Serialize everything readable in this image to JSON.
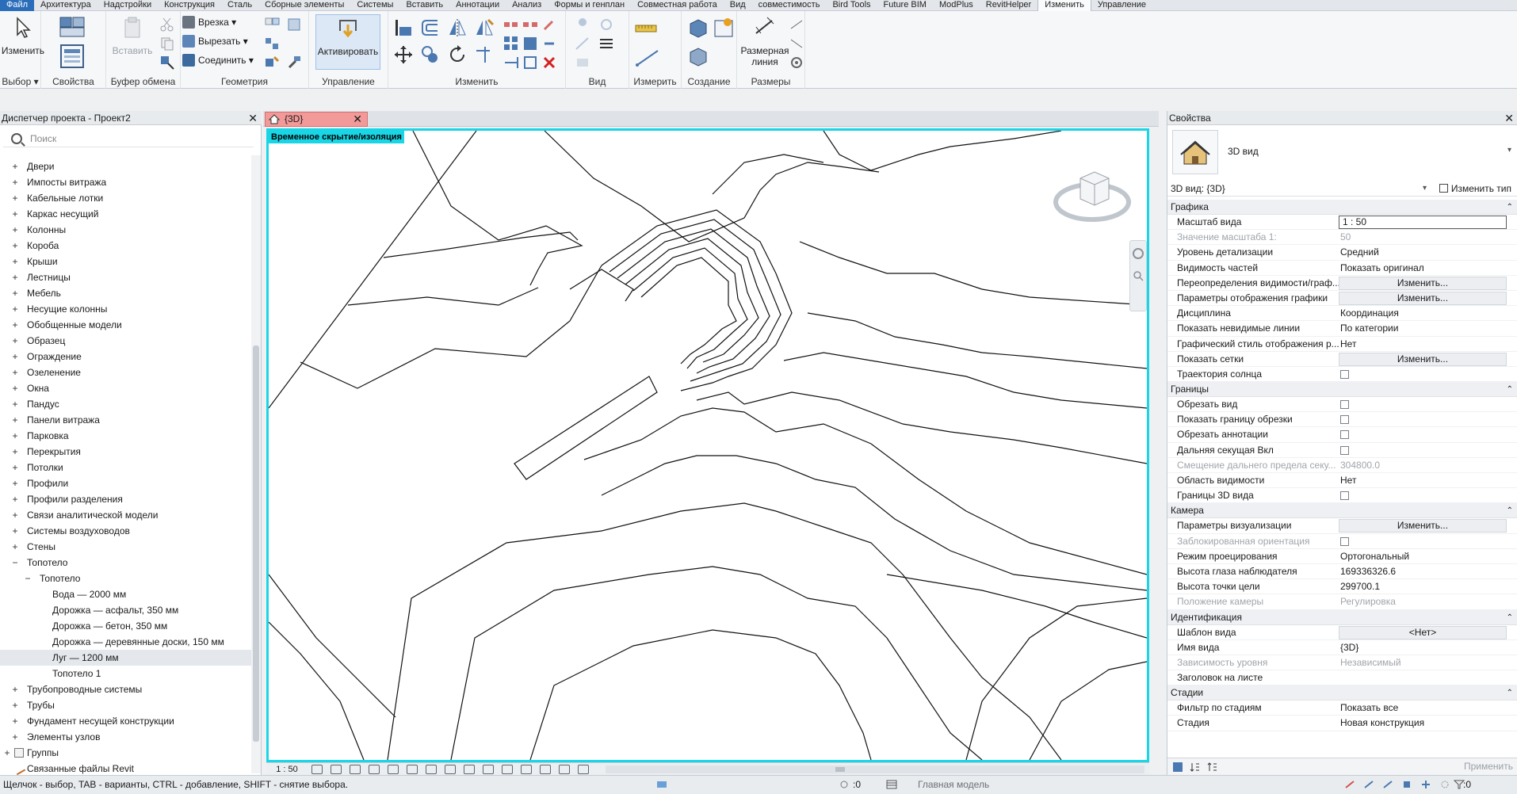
{
  "ribbon": {
    "tabs": [
      "Файл",
      "Архитектура",
      "Надстройки",
      "Конструкция",
      "Сталь",
      "Сборные элементы",
      "Системы",
      "Вставить",
      "Аннотации",
      "Анализ",
      "Формы и генплан",
      "Совместная работа",
      "Вид",
      "совместимость",
      "Bird Tools",
      "Future BIM",
      "ModPlus",
      "RevitHelper",
      "Изменить",
      "Управление"
    ],
    "active_tab": "Изменить",
    "groups": {
      "select_label": "Выбор",
      "properties_label": "Свойства",
      "clipboard_label": "Буфер обмена",
      "geometry_label": "Геометрия",
      "control_label": "Управление",
      "modify_label": "Изменить",
      "view_label": "Вид",
      "measure_label": "Измерить",
      "create_label": "Создание",
      "dimension_label": "Размеры"
    },
    "buttons": {
      "modify": "Изменить",
      "paste": "Вставить",
      "cut_in": "Врезка",
      "cut_out": "Вырезать",
      "join": "Соединить",
      "activate": "Активировать",
      "aligned_dim": "Размерная",
      "aligned_dim_2": "линия"
    }
  },
  "browser": {
    "title": "Диспетчер проекта - Проект2",
    "search_placeholder": "Поиск",
    "items": [
      {
        "label": "Двери",
        "level": 1,
        "expander": "+"
      },
      {
        "label": "Импосты витража",
        "level": 1,
        "expander": "+"
      },
      {
        "label": "Кабельные лотки",
        "level": 1,
        "expander": "+"
      },
      {
        "label": "Каркас несущий",
        "level": 1,
        "expander": "+"
      },
      {
        "label": "Колонны",
        "level": 1,
        "expander": "+"
      },
      {
        "label": "Короба",
        "level": 1,
        "expander": "+"
      },
      {
        "label": "Крыши",
        "level": 1,
        "expander": "+"
      },
      {
        "label": "Лестницы",
        "level": 1,
        "expander": "+"
      },
      {
        "label": "Мебель",
        "level": 1,
        "expander": "+"
      },
      {
        "label": "Несущие колонны",
        "level": 1,
        "expander": "+"
      },
      {
        "label": "Обобщенные модели",
        "level": 1,
        "expander": "+"
      },
      {
        "label": "Образец",
        "level": 1,
        "expander": "+"
      },
      {
        "label": "Ограждение",
        "level": 1,
        "expander": "+"
      },
      {
        "label": "Озеленение",
        "level": 1,
        "expander": "+"
      },
      {
        "label": "Окна",
        "level": 1,
        "expander": "+"
      },
      {
        "label": "Пандус",
        "level": 1,
        "expander": "+"
      },
      {
        "label": "Панели витража",
        "level": 1,
        "expander": "+"
      },
      {
        "label": "Парковка",
        "level": 1,
        "expander": "+"
      },
      {
        "label": "Перекрытия",
        "level": 1,
        "expander": "+"
      },
      {
        "label": "Потолки",
        "level": 1,
        "expander": "+"
      },
      {
        "label": "Профили",
        "level": 1,
        "expander": "+"
      },
      {
        "label": "Профили разделения",
        "level": 1,
        "expander": "+"
      },
      {
        "label": "Связи аналитической модели",
        "level": 1,
        "expander": "+"
      },
      {
        "label": "Системы воздуховодов",
        "level": 1,
        "expander": "+"
      },
      {
        "label": "Стены",
        "level": 1,
        "expander": "+"
      },
      {
        "label": "Топотело",
        "level": 1,
        "expander": "−"
      },
      {
        "label": "Топотело",
        "level": 2,
        "expander": "−"
      },
      {
        "label": "Вода — 2000 мм",
        "level": 3,
        "expander": ""
      },
      {
        "label": "Дорожка — асфальт, 350 мм",
        "level": 3,
        "expander": ""
      },
      {
        "label": "Дорожка — бетон, 350 мм",
        "level": 3,
        "expander": ""
      },
      {
        "label": "Дорожка — деревянные доски, 150 мм",
        "level": 3,
        "expander": ""
      },
      {
        "label": "Луг — 1200 мм",
        "level": 3,
        "expander": "",
        "selected": true
      },
      {
        "label": "Топотело 1",
        "level": 3,
        "expander": ""
      },
      {
        "label": "Трубопроводные системы",
        "level": 1,
        "expander": "+"
      },
      {
        "label": "Трубы",
        "level": 1,
        "expander": "+"
      },
      {
        "label": "Фундамент несущей конструкции",
        "level": 1,
        "expander": "+"
      },
      {
        "label": "Элементы узлов",
        "level": 1,
        "expander": "+"
      },
      {
        "label": "Группы",
        "level": 0,
        "expander": "+"
      },
      {
        "label": "Связанные файлы Revit",
        "level": 0,
        "expander": ""
      }
    ]
  },
  "view": {
    "tab_label": "{3D}",
    "isolation_label": "Временное скрытие/изоляция",
    "scale": "1 : 50"
  },
  "properties": {
    "title": "Свойства",
    "type_name": "3D вид",
    "instance": "3D вид: {3D}",
    "edit_type": "Изменить тип",
    "apply": "Применить",
    "sections": [
      {
        "name": "Графика",
        "rows": [
          {
            "name": "Масштаб вида",
            "value": "1 : 50",
            "kind": "input"
          },
          {
            "name": "Значение масштаба    1:",
            "value": "50",
            "kind": "text",
            "disabled": true
          },
          {
            "name": "Уровень детализации",
            "value": "Средний",
            "kind": "text"
          },
          {
            "name": "Видимость частей",
            "value": "Показать оригинал",
            "kind": "text"
          },
          {
            "name": "Переопределения видимости/граф...",
            "value": "Изменить...",
            "kind": "button"
          },
          {
            "name": "Параметры отображения графики",
            "value": "Изменить...",
            "kind": "button"
          },
          {
            "name": "Дисциплина",
            "value": "Координация",
            "kind": "text"
          },
          {
            "name": "Показать невидимые линии",
            "value": "По категории",
            "kind": "text"
          },
          {
            "name": "Графический стиль отображения р...",
            "value": "Нет",
            "kind": "text"
          },
          {
            "name": "Показать сетки",
            "value": "Изменить...",
            "kind": "button"
          },
          {
            "name": "Траектория солнца",
            "value": "",
            "kind": "check"
          }
        ]
      },
      {
        "name": "Границы",
        "rows": [
          {
            "name": "Обрезать вид",
            "value": "",
            "kind": "check"
          },
          {
            "name": "Показать границу обрезки",
            "value": "",
            "kind": "check"
          },
          {
            "name": "Обрезать аннотации",
            "value": "",
            "kind": "check"
          },
          {
            "name": "Дальняя секущая Вкл",
            "value": "",
            "kind": "check"
          },
          {
            "name": "Смещение дальнего предела секу...",
            "value": "304800.0",
            "kind": "text",
            "disabled": true
          },
          {
            "name": "Область видимости",
            "value": "Нет",
            "kind": "text"
          },
          {
            "name": "Границы 3D вида",
            "value": "",
            "kind": "check"
          }
        ]
      },
      {
        "name": "Камера",
        "rows": [
          {
            "name": "Параметры визуализации",
            "value": "Изменить...",
            "kind": "button"
          },
          {
            "name": "Заблокированная ориентация",
            "value": "",
            "kind": "check",
            "disabled": true
          },
          {
            "name": "Режим проецирования",
            "value": "Ортогональный",
            "kind": "text"
          },
          {
            "name": "Высота глаза наблюдателя",
            "value": "169336326.6",
            "kind": "text"
          },
          {
            "name": "Высота точки цели",
            "value": "299700.1",
            "kind": "text"
          },
          {
            "name": "Положение камеры",
            "value": "Регулировка",
            "kind": "text",
            "disabled": true
          }
        ]
      },
      {
        "name": "Идентификация",
        "rows": [
          {
            "name": "Шаблон вида",
            "value": "<Нет>",
            "kind": "button"
          },
          {
            "name": "Имя вида",
            "value": "{3D}",
            "kind": "text"
          },
          {
            "name": "Зависимость уровня",
            "value": "Независимый",
            "kind": "text",
            "disabled": true
          },
          {
            "name": "Заголовок на листе",
            "value": "",
            "kind": "text"
          }
        ]
      },
      {
        "name": "Стадии",
        "rows": [
          {
            "name": "Фильтр по стадиям",
            "value": "Показать все",
            "kind": "text"
          },
          {
            "name": "Стадия",
            "value": "Новая конструкция",
            "kind": "text"
          }
        ]
      }
    ]
  },
  "status": {
    "hint": "Щелчок - выбор, TAB - варианты, CTRL - добавление, SHIFT - снятие выбора.",
    "zero1": ":0",
    "model": "Главная модель",
    "zero2": ":0"
  },
  "colors": {
    "viewport_border": "#19d6e6",
    "view_tab": "#f29a9a",
    "file_tab": "#2a6ebb"
  }
}
